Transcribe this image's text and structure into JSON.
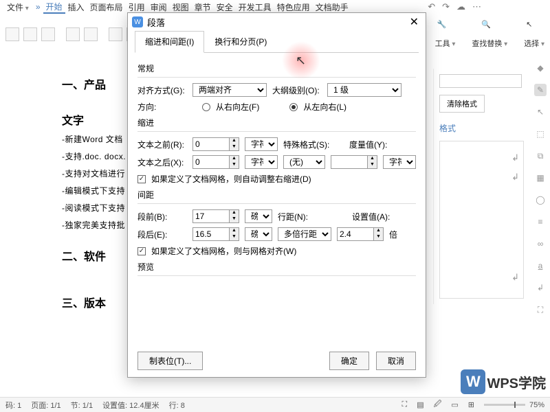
{
  "menubar": {
    "file": "文件",
    "items": [
      "开始",
      "插入",
      "页面布局",
      "引用",
      "审阅",
      "视图",
      "章节",
      "安全",
      "开发工具",
      "特色应用",
      "文档助手"
    ],
    "active_index": 0
  },
  "ribbon_right": [
    {
      "label": "工具",
      "caret": true
    },
    {
      "label": "查找替换",
      "caret": true
    },
    {
      "label": "选择",
      "caret": true
    }
  ],
  "panel": {
    "clear": "清除格式",
    "link": "格式"
  },
  "doc": {
    "h1": "一、产品",
    "h1b": "文字",
    "lines": [
      "-新建Word 文档",
      "-支持.doc. docx.",
      "-支持对文档进行",
      "-编辑模式下支持",
      "-阅读模式下支持",
      "-独家完美支持批"
    ],
    "h2": "二、软件",
    "h3": "三、版本"
  },
  "dialog": {
    "title": "段落",
    "tabs": [
      "缩进和间距(I)",
      "换行和分页(P)"
    ],
    "sections": {
      "general": "常规",
      "indent": "缩进",
      "spacing": "间距",
      "preview": "预览"
    },
    "labels": {
      "align": "对齐方式(G):",
      "outline": "大纲级别(O):",
      "direction": "方向:",
      "rtl": "从右向左(F)",
      "ltr": "从左向右(L)",
      "before_text": "文本之前(R):",
      "after_text": "文本之后(X):",
      "special": "特殊格式(S):",
      "measure": "度量值(Y):",
      "unit_char": "字符",
      "auto_indent": "如果定义了文档网格，则自动调整右缩进(D)",
      "before_para": "段前(B):",
      "after_para": "段后(E):",
      "line_spacing": "行距(N):",
      "set_value": "设置值(A):",
      "unit_pt": "磅",
      "unit_x": "倍",
      "snap_grid": "如果定义了文档网格，则与网格对齐(W)"
    },
    "values": {
      "align": "两端对齐",
      "outline": "1 级",
      "before_text": "0",
      "after_text": "0",
      "special": "(无)",
      "measure": "",
      "before_para": "17",
      "after_para": "16.5",
      "line_spacing": "多倍行距",
      "set_value": "2.4",
      "direction": "ltr",
      "auto_indent": true,
      "snap_grid": true
    },
    "footer": {
      "tabstops": "制表位(T)...",
      "ok": "确定",
      "cancel": "取消"
    }
  },
  "statusbar": {
    "page_label": "码:",
    "page_val": "1",
    "pages": "页面: 1/1",
    "section": "节: 1/1",
    "set": "设置值: 12.4厘米",
    "line": "行: 8",
    "zoom": "75%"
  },
  "logo": "WPS学院"
}
